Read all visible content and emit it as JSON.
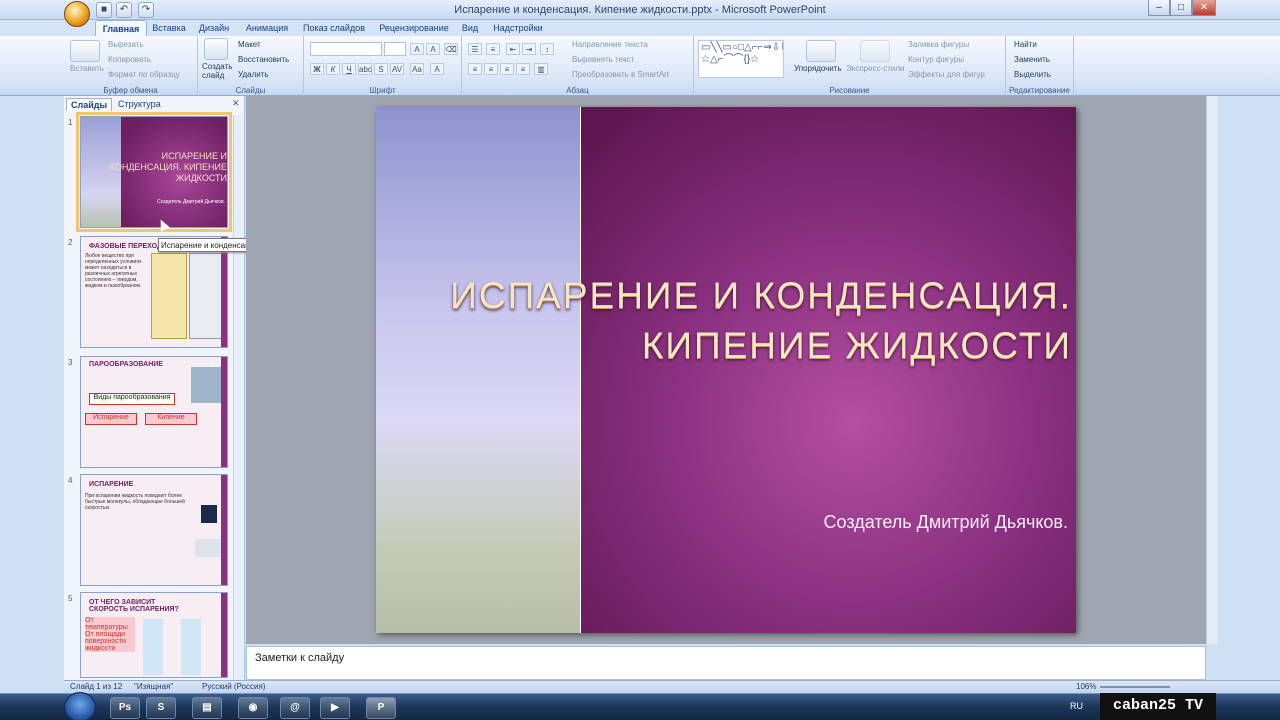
{
  "window": {
    "title": "Испарение и конденсация. Кипение жидкости.pptx - Microsoft PowerPoint"
  },
  "ribbon_tabs": [
    "Главная",
    "Вставка",
    "Дизайн",
    "Анимация",
    "Показ слайдов",
    "Рецензирование",
    "Вид",
    "Надстройки"
  ],
  "groups": {
    "clipboard": {
      "label": "Буфер обмена",
      "paste": "Вставить",
      "cut": "Вырезать",
      "copy": "Копировать",
      "format": "Формат по образцу"
    },
    "slides": {
      "label": "Слайды",
      "create": "Создать слайд",
      "layout": "Макет",
      "reset": "Восстановить",
      "delete": "Удалить"
    },
    "font": {
      "label": "Шрифт"
    },
    "paragraph": {
      "label": "Абзац",
      "direction": "Направление текста",
      "align": "Выровнять текст",
      "smartart": "Преобразовать в SmartArt"
    },
    "drawing": {
      "label": "Рисование",
      "arrange": "Упорядочить",
      "styles": "Экспресс-стили",
      "fill": "Заливка фигуры",
      "outline": "Контур фигуры",
      "effects": "Эффекты для фигур"
    },
    "editing": {
      "label": "Редактирование",
      "find": "Найти",
      "replace": "Заменить",
      "select": "Выделить"
    }
  },
  "left_tabs": [
    "Слайды",
    "Структура"
  ],
  "thumbnails": [
    {
      "num": "1",
      "title": "Испарение и конденсация. Кипение жидкости",
      "sub": "Создатель Дмитрий Дьячков."
    },
    {
      "num": "2",
      "title": "Фазовые переходы",
      "sub": "Любое вещество при определенных условиях может находиться в различных агрегатных состояниях – твердом, жидком и газообразном."
    },
    {
      "num": "3",
      "title": "Парообразование",
      "box": "Виды парообразования",
      "a": "Испарение",
      "b": "Кипение"
    },
    {
      "num": "4",
      "title": "Испарение",
      "sub": "При испарении жидкость покидают более быстрые молекулы, обладающие большей скоростью."
    },
    {
      "num": "5",
      "title": "От чего зависит скорость испарения?",
      "a": "От температуры",
      "b": "От площади поверхности жидкости"
    }
  ],
  "tooltip": "Испарение и конденсация. Ки...",
  "slide": {
    "title": "Испарение и конденсация. Кипение жидкости",
    "subtitle": "Создатель Дмитрий Дьячков."
  },
  "notes_placeholder": "Заметки к слайду",
  "status": {
    "slide": "Слайд 1 из 12",
    "theme": "\"Изящная\"",
    "language": "Русский (Россия)",
    "zoom": "106%"
  },
  "taskbar": {
    "lang": "RU",
    "watermark": "caban25 TV"
  }
}
